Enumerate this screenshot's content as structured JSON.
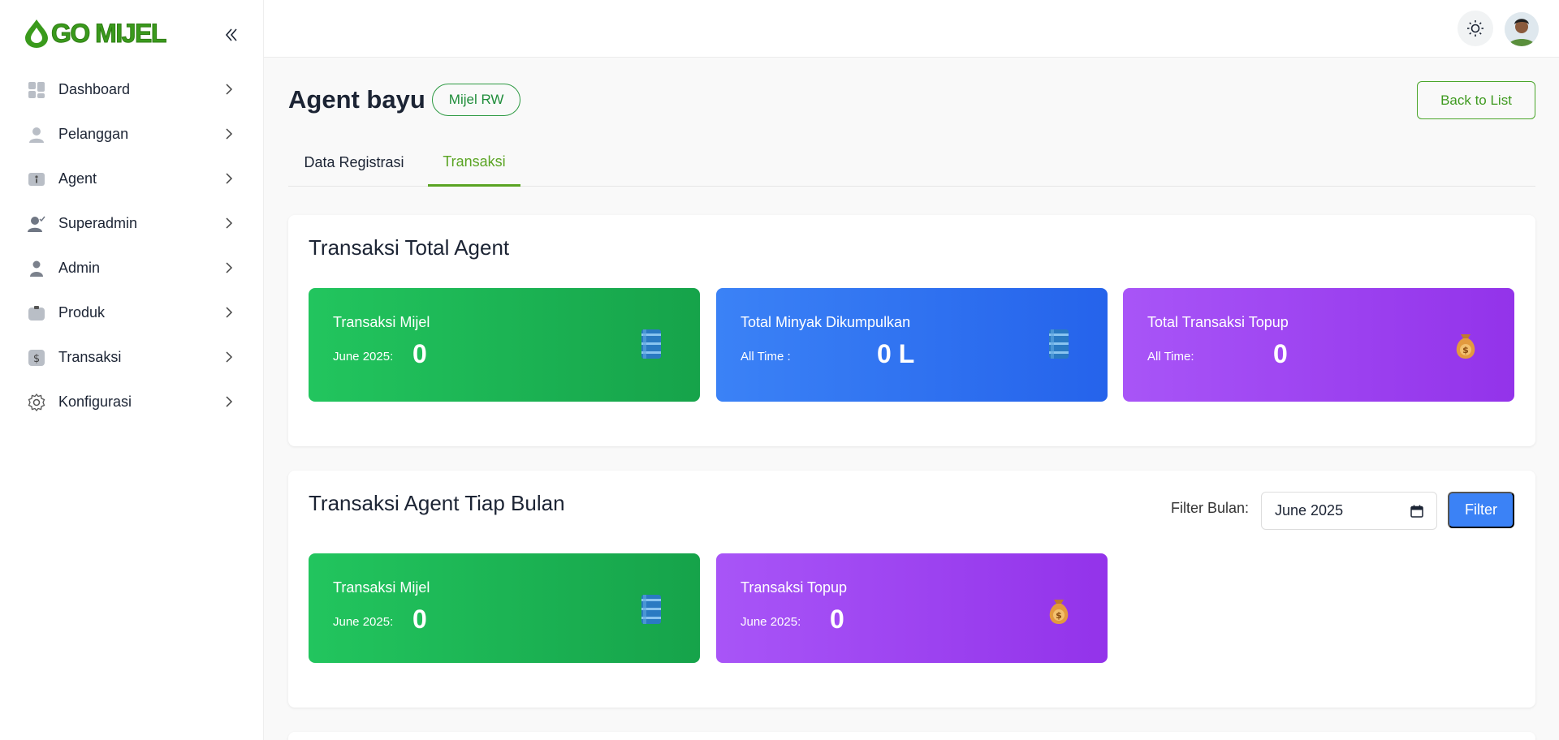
{
  "app": {
    "logo_text": "GO MIJEL"
  },
  "sidebar": {
    "items": [
      {
        "label": "Dashboard",
        "icon": "dashboard-icon"
      },
      {
        "label": "Pelanggan",
        "icon": "user-icon"
      },
      {
        "label": "Agent",
        "icon": "agent-icon"
      },
      {
        "label": "Superadmin",
        "icon": "user-check-icon"
      },
      {
        "label": "Admin",
        "icon": "user-icon"
      },
      {
        "label": "Produk",
        "icon": "product-icon"
      },
      {
        "label": "Transaksi",
        "icon": "dollar-icon"
      },
      {
        "label": "Konfigurasi",
        "icon": "gear-icon"
      }
    ]
  },
  "header": {
    "theme_icon": "sun-icon",
    "avatar_icon": "avatar"
  },
  "page": {
    "title": "Agent bayu",
    "badge": "Mijel RW",
    "back_label": "Back to List",
    "tabs": [
      {
        "label": "Data Registrasi",
        "active": false
      },
      {
        "label": "Transaksi",
        "active": true
      }
    ]
  },
  "total": {
    "title": "Transaksi Total Agent",
    "cards": [
      {
        "title": "Transaksi Mijel",
        "sub": "June 2025:",
        "value": "0",
        "color": "#22c55e",
        "icon": "oil-barrel-icon"
      },
      {
        "title": "Total Minyak Dikumpulkan",
        "sub": "All Time :",
        "value": "0 L",
        "color": "#3b82f6",
        "icon": "oil-barrel-icon"
      },
      {
        "title": "Total Transaksi Topup",
        "sub": "All Time:",
        "value": "0",
        "color": "#a855f7",
        "icon": "money-bag-icon"
      }
    ]
  },
  "monthly": {
    "title": "Transaksi Agent Tiap Bulan",
    "filter_label": "Filter Bulan:",
    "filter_value": "June 2025",
    "filter_button": "Filter",
    "cards": [
      {
        "title": "Transaksi Mijel",
        "sub": "June 2025:",
        "value": "0",
        "color": "#22c55e",
        "icon": "oil-barrel-icon"
      },
      {
        "title": "Transaksi Topup",
        "sub": "June 2025:",
        "value": "0",
        "color": "#a855f7",
        "icon": "money-bag-icon"
      }
    ]
  }
}
